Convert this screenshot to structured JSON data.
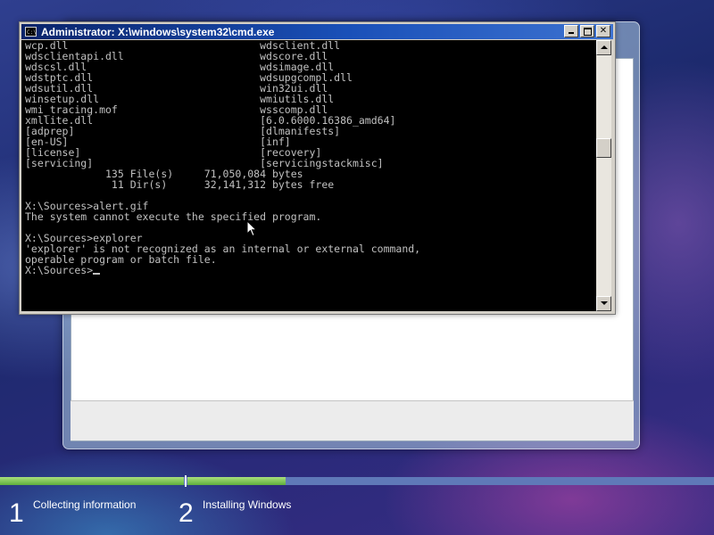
{
  "cmd": {
    "title": "Administrator: X:\\windows\\system32\\cmd.exe",
    "icon": "cmd-icon",
    "output": "wcp.dll                               wdsclient.dll\nwdsclientapi.dll                      wdscore.dll\nwdscsl.dll                            wdsimage.dll\nwdstptc.dll                           wdsupgcompl.dll\nwdsutil.dll                           win32ui.dll\nwinsetup.dll                          wmiutils.dll\nwmi_tracing.mof                       wsscomp.dll\nxmllite.dll                           [6.0.6000.16386_amd64]\n[adprep]                              [dlmanifests]\n[en-US]                               [inf]\n[license]                             [recovery]\n[servicing]                           [servicingstackmisc]\n             135 File(s)     71,050,084 bytes\n              11 Dir(s)      32,141,312 bytes free\n\nX:\\Sources>alert.gif\nThe system cannot execute the specified program.\n\nX:\\Sources>explorer\n'explorer' is not recognized as an internal or external command,\noperable program or batch file.\n",
    "prompt": "X:\\Sources>"
  },
  "setup": {
    "steps": [
      {
        "number": "1",
        "label": "Collecting information"
      },
      {
        "number": "2",
        "label": "Installing Windows"
      }
    ]
  },
  "colors": {
    "console_bg": "#000000",
    "console_text": "#c0c0c0",
    "titlebar": "#0a246a",
    "progress_fill": "#6cbf45",
    "progress_track": "#5f79b8"
  }
}
